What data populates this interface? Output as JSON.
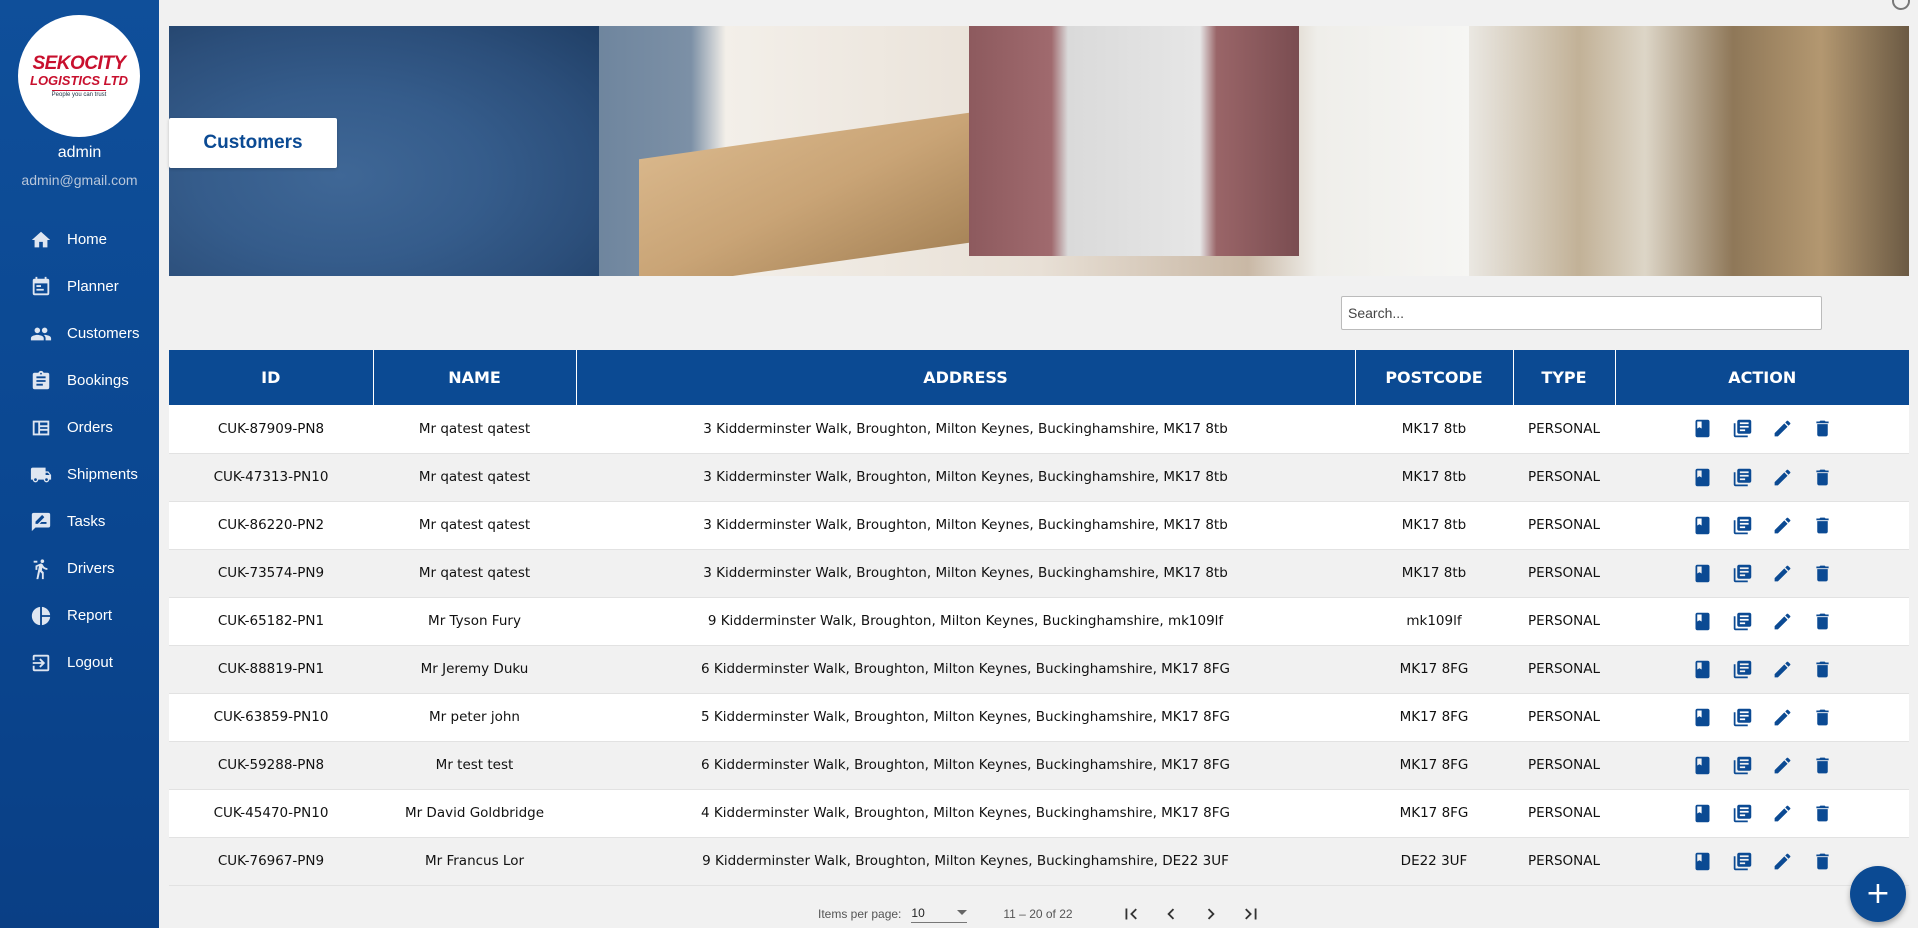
{
  "brand": {
    "logo_line1": "SEKOCITY",
    "logo_line2": "LOGISTICS LTD",
    "logo_tagline": "People you can trust",
    "primary_color": "#0b4a93"
  },
  "user": {
    "name": "admin",
    "email": "admin@gmail.com"
  },
  "sidebar": {
    "items": [
      {
        "label": "Home",
        "icon": "home-icon"
      },
      {
        "label": "Planner",
        "icon": "calendar-icon"
      },
      {
        "label": "Customers",
        "icon": "people-icon"
      },
      {
        "label": "Bookings",
        "icon": "clipboard-icon"
      },
      {
        "label": "Orders",
        "icon": "orders-icon"
      },
      {
        "label": "Shipments",
        "icon": "truck-icon"
      },
      {
        "label": "Tasks",
        "icon": "task-icon"
      },
      {
        "label": "Drivers",
        "icon": "driver-icon"
      },
      {
        "label": "Report",
        "icon": "pie-chart-icon"
      },
      {
        "label": "Logout",
        "icon": "logout-icon"
      }
    ]
  },
  "page": {
    "title": "Customers"
  },
  "search": {
    "placeholder": "Search..."
  },
  "table": {
    "headers": {
      "id": "ID",
      "name": "NAME",
      "address": "ADDRESS",
      "postcode": "POSTCODE",
      "type": "TYPE",
      "action": "ACTION"
    },
    "rows": [
      {
        "id": "CUK-87909-PN8",
        "name": "Mr qatest qatest",
        "address": "3 Kidderminster Walk, Broughton, Milton Keynes, Buckinghamshire, MK17 8tb",
        "postcode": "MK17 8tb",
        "type": "PERSONAL"
      },
      {
        "id": "CUK-47313-PN10",
        "name": "Mr qatest qatest",
        "address": "3 Kidderminster Walk, Broughton, Milton Keynes, Buckinghamshire, MK17 8tb",
        "postcode": "MK17 8tb",
        "type": "PERSONAL"
      },
      {
        "id": "CUK-86220-PN2",
        "name": "Mr qatest qatest",
        "address": "3 Kidderminster Walk, Broughton, Milton Keynes, Buckinghamshire, MK17 8tb",
        "postcode": "MK17 8tb",
        "type": "PERSONAL"
      },
      {
        "id": "CUK-73574-PN9",
        "name": "Mr qatest qatest",
        "address": "3 Kidderminster Walk, Broughton, Milton Keynes, Buckinghamshire, MK17 8tb",
        "postcode": "MK17 8tb",
        "type": "PERSONAL"
      },
      {
        "id": "CUK-65182-PN1",
        "name": "Mr Tyson Fury",
        "address": "9 Kidderminster Walk, Broughton, Milton Keynes, Buckinghamshire, mk109lf",
        "postcode": "mk109lf",
        "type": "PERSONAL"
      },
      {
        "id": "CUK-88819-PN1",
        "name": "Mr Jeremy Duku",
        "address": "6 Kidderminster Walk, Broughton, Milton Keynes, Buckinghamshire, MK17 8FG",
        "postcode": "MK17 8FG",
        "type": "PERSONAL"
      },
      {
        "id": "CUK-63859-PN10",
        "name": "Mr peter john",
        "address": "5 Kidderminster Walk, Broughton, Milton Keynes, Buckinghamshire, MK17 8FG",
        "postcode": "MK17 8FG",
        "type": "PERSONAL"
      },
      {
        "id": "CUK-59288-PN8",
        "name": "Mr test test",
        "address": "6 Kidderminster Walk, Broughton, Milton Keynes, Buckinghamshire, MK17 8FG",
        "postcode": "MK17 8FG",
        "type": "PERSONAL"
      },
      {
        "id": "CUK-45470-PN10",
        "name": "Mr David Goldbridge",
        "address": "4 Kidderminster Walk, Broughton, Milton Keynes, Buckinghamshire, MK17 8FG",
        "postcode": "MK17 8FG",
        "type": "PERSONAL"
      },
      {
        "id": "CUK-76967-PN9",
        "name": "Mr Francus Lor",
        "address": "9 Kidderminster Walk, Broughton, Milton Keynes, Buckinghamshire, DE22 3UF",
        "postcode": "DE22 3UF",
        "type": "PERSONAL"
      }
    ],
    "row_actions": [
      "book-icon",
      "library-books-icon",
      "edit-icon",
      "delete-icon"
    ]
  },
  "paginator": {
    "items_per_page_label": "Items per page:",
    "items_per_page": "10",
    "range": "11 – 20 of 22"
  },
  "fab": {
    "label": "+"
  }
}
